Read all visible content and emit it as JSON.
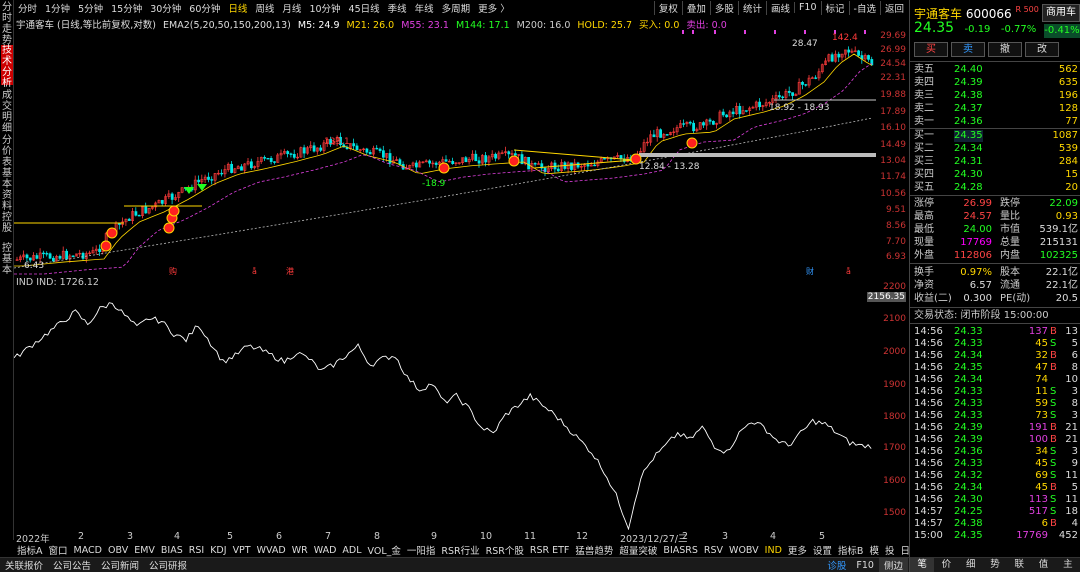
{
  "left_tabs": [
    "分时走势",
    "技术分析",
    "成交明细",
    "分价表",
    "基本资料",
    "控股",
    "控基本"
  ],
  "toolbar": {
    "periods": [
      "分时",
      "1分钟",
      "5分钟",
      "15分钟",
      "30分钟",
      "60分钟",
      "日线",
      "周线",
      "月线",
      "10分钟",
      "45日线",
      "季线",
      "年线",
      "多周期",
      "更多 〉"
    ],
    "selected": "日线",
    "right_tools": [
      "复权",
      "叠加",
      "多股",
      "统计",
      "画线",
      "F10",
      "标记",
      "-自选",
      "返回"
    ]
  },
  "legend": {
    "name": "宇通客车 (日线,等比前复权,对数)",
    "ema": "EMA2(5,20,50,150,200,13)",
    "m5": "M5: 24.9",
    "m21": "M21: 26.0",
    "m55": "M55: 23.1",
    "m144": "M144: 17.1",
    "m200": "M200: 16.0",
    "hold": "HOLD: 25.7",
    "buy": "买入: 0.0",
    "sell": "卖出: 0.0"
  },
  "main_yaxis": [
    "29.69",
    "26.99",
    "24.54",
    "22.31",
    "19.88",
    "17.89",
    "16.10",
    "14.49",
    "13.04",
    "11.74",
    "10.56",
    "9.51",
    "8.56",
    "7.70",
    "6.93"
  ],
  "annotations": {
    "high_label": "28.47",
    "peak_label": "142.4",
    "range1": "18.92 - 18.93",
    "range2": "12.84 - 13.28",
    "low_label": "6.43",
    "mid_label": "-18.9",
    "top_label": "133.1",
    "markers": [
      "购",
      "å",
      "港",
      "财",
      "å"
    ]
  },
  "sub_legend": "IND  IND: 1726.12",
  "sub_yaxis": [
    "2200",
    "2156.35",
    "2100",
    "2000",
    "1900",
    "1800",
    "1700",
    "1600",
    "1500"
  ],
  "xaxis": [
    "2022年",
    "2",
    "3",
    "4",
    "5",
    "6",
    "7",
    "8",
    "9",
    "10",
    "11",
    "12",
    "2023/12/27/三",
    "2",
    "3",
    "4",
    "5"
  ],
  "indicators": [
    "指标A",
    "窗口",
    "MACD",
    "OBV",
    "EMV",
    "BIAS",
    "RSI",
    "KDJ",
    "VPT",
    "WVAD",
    "WR",
    "WAD",
    "ADL",
    "VOL_金",
    "一阳指",
    "RSR行业",
    "RSR个股",
    "RSR ETF",
    "猛兽趋势",
    "超量突破",
    "BIASRS",
    "RSV",
    "WOBV",
    "IND",
    "更多",
    "设置"
  ],
  "indicator_selected": "IND",
  "indicator_right": [
    "指标B",
    "模",
    "投",
    "日线"
  ],
  "bottom_bar": [
    "关联报价",
    "公司公告",
    "公司新闻",
    "公司研报"
  ],
  "bottom_right": [
    "诊股",
    "F10",
    "侧边"
  ],
  "stock": {
    "name": "宇通客车",
    "code": "600066",
    "tag": "R 500",
    "price": "24.35",
    "change": "-0.19",
    "change_pct": "-0.77%",
    "pct_badge": "-0.41%",
    "tag_button": "商用车"
  },
  "trade_buttons": [
    "买",
    "卖",
    "撤",
    "改"
  ],
  "sell_orders": [
    {
      "label": "卖五",
      "price": "24.40",
      "vol": "562"
    },
    {
      "label": "卖四",
      "price": "24.39",
      "vol": "635"
    },
    {
      "label": "卖三",
      "price": "24.38",
      "vol": "196"
    },
    {
      "label": "卖二",
      "price": "24.37",
      "vol": "128"
    },
    {
      "label": "卖一",
      "price": "24.36",
      "vol": "77"
    }
  ],
  "buy_orders": [
    {
      "label": "买一",
      "price": "24.35",
      "vol": "1087"
    },
    {
      "label": "买二",
      "price": "24.34",
      "vol": "539"
    },
    {
      "label": "买三",
      "price": "24.31",
      "vol": "284"
    },
    {
      "label": "买四",
      "price": "24.30",
      "vol": "15"
    },
    {
      "label": "买五",
      "price": "24.28",
      "vol": "20"
    }
  ],
  "stats": [
    {
      "k1": "涨停",
      "v1": "26.99",
      "k2": "跌停",
      "v2": "22.09"
    },
    {
      "k1": "最高",
      "v1": "24.57",
      "k2": "量比",
      "v2": "0.93"
    },
    {
      "k1": "最低",
      "v1": "24.00",
      "k2": "市值",
      "v2": "539.1亿"
    },
    {
      "k1": "现量",
      "v1": "17769",
      "k2": "总量",
      "v2": "215131"
    },
    {
      "k1": "外盘",
      "v1": "112806",
      "k2": "内盘",
      "v2": "102325"
    }
  ],
  "stats2": [
    {
      "k1": "换手",
      "v1": "0.97%",
      "k2": "股本",
      "v2": "22.1亿"
    },
    {
      "k1": "净资",
      "v1": "6.57",
      "k2": "流通",
      "v2": "22.1亿"
    },
    {
      "k1": "收益(二)",
      "v1": "0.300",
      "k2": "PE(动)",
      "v2": "20.5"
    }
  ],
  "trade_status": "交易状态: 闭市阶段 15:00:00",
  "ticks": [
    {
      "t": "14:56",
      "p": "24.33",
      "v": "137",
      "s": "B",
      "n": "13"
    },
    {
      "t": "14:56",
      "p": "24.33",
      "v": "45",
      "s": "S",
      "n": "5"
    },
    {
      "t": "14:56",
      "p": "24.34",
      "v": "32",
      "s": "B",
      "n": "6"
    },
    {
      "t": "14:56",
      "p": "24.35",
      "v": "47",
      "s": "B",
      "n": "8"
    },
    {
      "t": "14:56",
      "p": "24.34",
      "v": "74",
      "s": "",
      "n": "10"
    },
    {
      "t": "14:56",
      "p": "24.33",
      "v": "11",
      "s": "S",
      "n": "3"
    },
    {
      "t": "14:56",
      "p": "24.33",
      "v": "59",
      "s": "S",
      "n": "8"
    },
    {
      "t": "14:56",
      "p": "24.33",
      "v": "73",
      "s": "S",
      "n": "3"
    },
    {
      "t": "14:56",
      "p": "24.39",
      "v": "191",
      "s": "B",
      "n": "21"
    },
    {
      "t": "14:56",
      "p": "24.39",
      "v": "100",
      "s": "B",
      "n": "21"
    },
    {
      "t": "14:56",
      "p": "24.36",
      "v": "34",
      "s": "S",
      "n": "3"
    },
    {
      "t": "14:56",
      "p": "24.33",
      "v": "45",
      "s": "S",
      "n": "9"
    },
    {
      "t": "14:56",
      "p": "24.32",
      "v": "69",
      "s": "S",
      "n": "11"
    },
    {
      "t": "14:56",
      "p": "24.34",
      "v": "45",
      "s": "B",
      "n": "5"
    },
    {
      "t": "14:56",
      "p": "24.30",
      "v": "113",
      "s": "S",
      "n": "11"
    },
    {
      "t": "14:57",
      "p": "24.25",
      "v": "517",
      "s": "S",
      "n": "18"
    },
    {
      "t": "14:57",
      "p": "24.38",
      "v": "6",
      "s": "B",
      "n": "4"
    },
    {
      "t": "15:00",
      "p": "24.35",
      "v": "17769",
      "s": "",
      "n": "452"
    }
  ],
  "rp_bottom": [
    "笔",
    "价",
    "细",
    "势",
    "联",
    "值",
    "主"
  ]
}
